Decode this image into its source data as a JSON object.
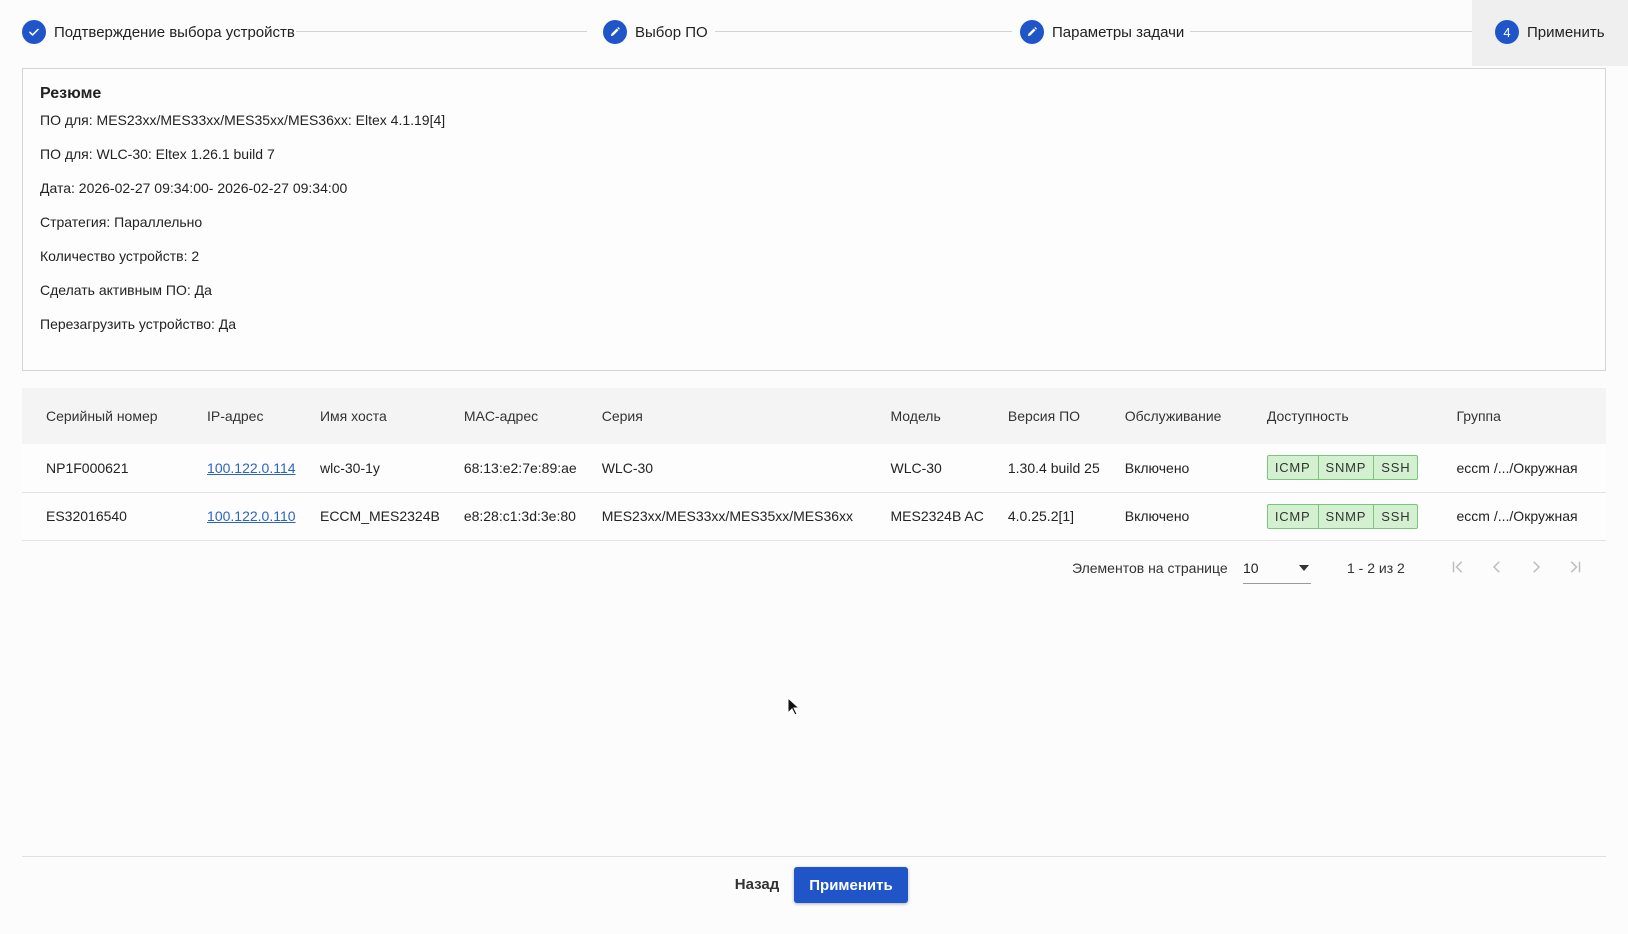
{
  "stepper": {
    "steps": [
      {
        "label": "Подтверждение выбора устройств",
        "icon": "check-icon"
      },
      {
        "label": "Выбор ПО",
        "icon": "pencil-icon"
      },
      {
        "label": "Параметры задачи",
        "icon": "pencil-icon"
      },
      {
        "label": "Применить",
        "number": "4"
      }
    ]
  },
  "summary": {
    "title": "Резюме",
    "rows": [
      {
        "label": "ПО для: MES23xx/MES33xx/MES35xx/MES36xx:",
        "value": "Eltex 4.1.19[4]"
      },
      {
        "label": "ПО для: WLC-30:",
        "value": "Eltex 1.26.1 build 7"
      },
      {
        "label": "Дата:",
        "value": "2026-02-27 09:34:00- 2026-02-27 09:34:00"
      },
      {
        "label": "Стратегия:",
        "value": "Параллельно"
      },
      {
        "label": "Количество устройств:",
        "value": "2"
      },
      {
        "label": "Сделать активным ПО:",
        "value": "Да"
      },
      {
        "label": "Перезагрузить устройство:",
        "value": "Да"
      }
    ]
  },
  "table": {
    "columns": [
      "Серийный номер",
      "IP-адрес",
      "Имя хоста",
      "MAC-адрес",
      "Серия",
      "Модель",
      "Версия ПО",
      "Обслуживание",
      "Доступность",
      "Группа"
    ],
    "rows": [
      {
        "serial": "NP1F000621",
        "ip": "100.122.0.114",
        "host": "wlc-30-1y",
        "mac": "68:13:e2:7e:89:ae",
        "series": "WLC-30",
        "model": "WLC-30",
        "version": "1.30.4 build 25",
        "service": "Включено",
        "avail": [
          "ICMP",
          "SNMP",
          "SSH"
        ],
        "group": "eccm /.../Окружная"
      },
      {
        "serial": "ES32016540",
        "ip": "100.122.0.110",
        "host": "ECCM_MES2324B",
        "mac": "e8:28:c1:3d:3e:80",
        "series": "MES23xx/MES33xx/MES35xx/MES36xx",
        "model": "MES2324B AC",
        "version": "4.0.25.2[1]",
        "service": "Включено",
        "avail": [
          "ICMP",
          "SNMP",
          "SSH"
        ],
        "group": "eccm /.../Окружная"
      }
    ]
  },
  "pagination": {
    "per_page_label": "Элементов на странице",
    "per_page_value": "10",
    "range": "1 - 2 из 2"
  },
  "footer": {
    "back_label": "Назад",
    "apply_label": "Применить"
  },
  "colors": {
    "accent": "#1f55c9",
    "link": "#2a64c5",
    "badge_bg": "#d3f0d0",
    "badge_border": "#7bc47b"
  }
}
